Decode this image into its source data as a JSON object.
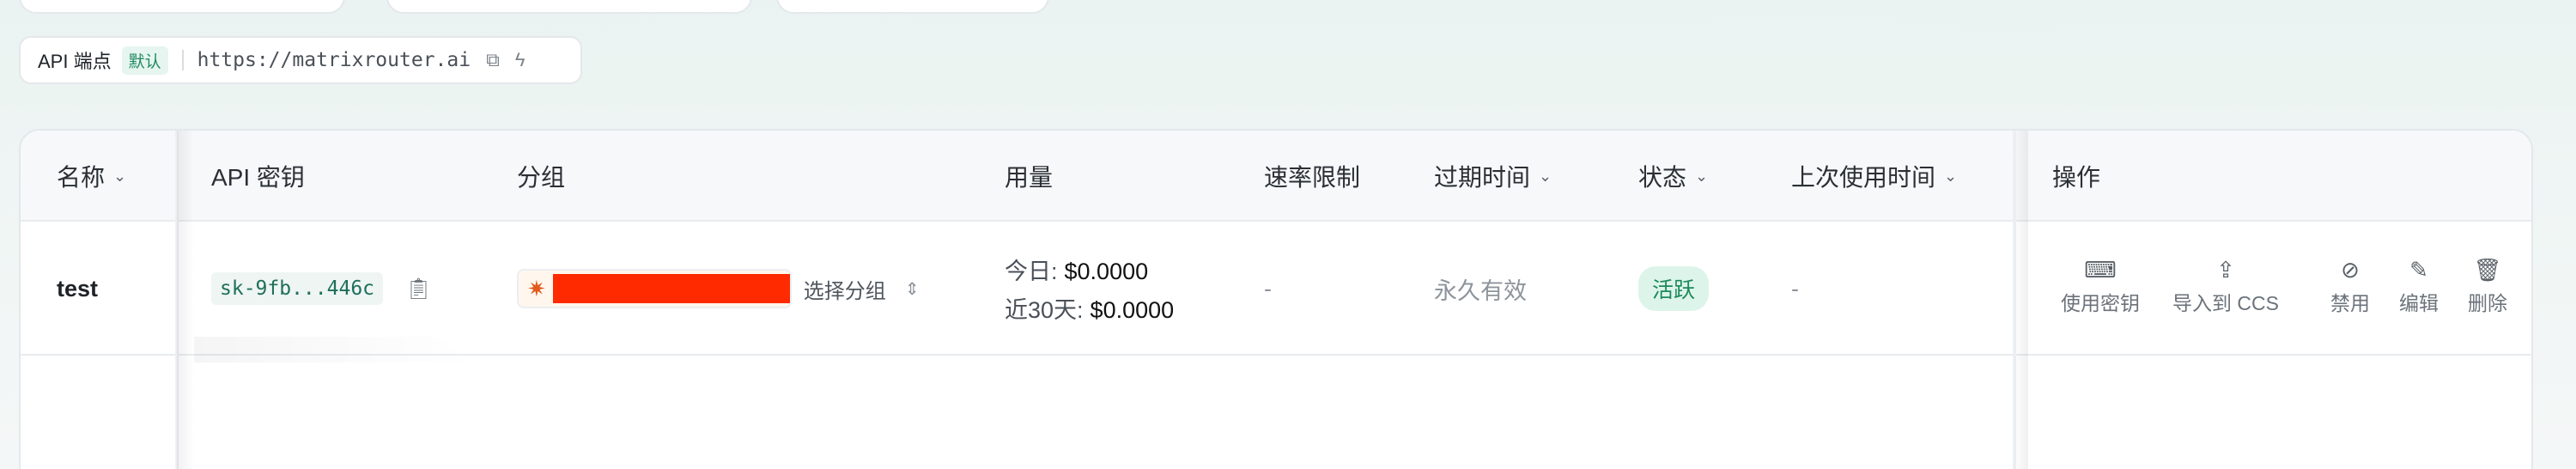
{
  "endpoint": {
    "label": "API 端点",
    "badge": "默认",
    "url": "https://matrixrouter.ai",
    "copy_icon": "copy-icon",
    "test_icon": "lightning-icon"
  },
  "table": {
    "headers": {
      "name": "名称",
      "key": "API 密钥",
      "group": "分组",
      "usage": "用量",
      "rate": "速率限制",
      "expiry": "过期时间",
      "status": "状态",
      "last_used": "上次使用时间",
      "actions": "操作"
    },
    "rows": [
      {
        "name": "test",
        "key": "sk-9fb...446c",
        "group_select": "选择分组",
        "usage_today_label": "今日:",
        "usage_today": "$0.0000",
        "usage_30d_label": "近30天:",
        "usage_30d": "$0.0000",
        "rate": "-",
        "expiry": "永久有效",
        "status": "活跃",
        "last_used": "-",
        "actions": {
          "use_key": "使用密钥",
          "import_ccs": "导入到 CCS",
          "disable": "禁用",
          "edit": "编辑",
          "delete": "删除"
        }
      }
    ]
  },
  "colors": {
    "accent_green": "#1b8a5a",
    "redaction": "#ff2a00",
    "brand_spark": "#e05a1c"
  }
}
